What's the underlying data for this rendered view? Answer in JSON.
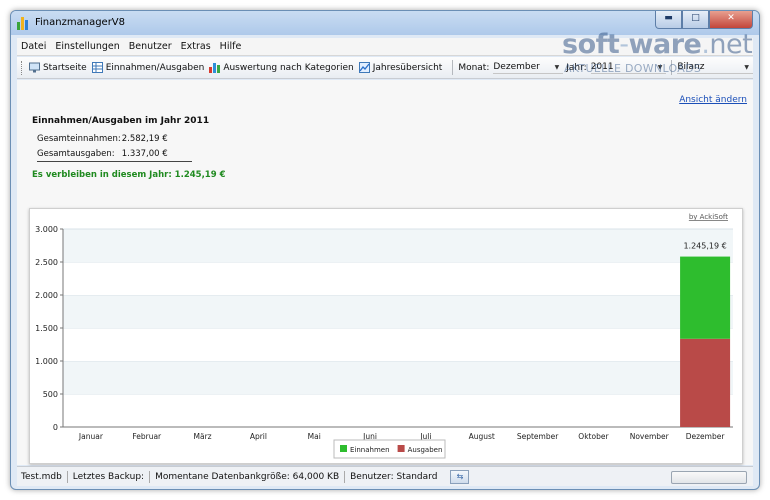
{
  "window": {
    "title": "FinanzmanagerV8"
  },
  "menu": [
    "Datei",
    "Einstellungen",
    "Benutzer",
    "Extras",
    "Hilfe"
  ],
  "toolbar": {
    "start": "Startseite",
    "income_expense": "Einnahmen/Ausgaben",
    "by_category": "Auswertung nach Kategorien",
    "year_overview": "Jahresübersicht",
    "month_label": "Monat:",
    "month_value": "Dezember",
    "year_label": "Jahr:",
    "year_value": "2011",
    "view_value": "Bilanz"
  },
  "summary": {
    "change_view_link": "Ansicht ändern",
    "title": "Einnahmen/Ausgaben im Jahr 2011",
    "income_label": "Gesamteinnahmen:",
    "income_value": "2.582,19 €",
    "expense_label": "Gesamtausgaben:",
    "expense_value": "1.337,00 €",
    "remaining": "Es verbleiben in diesem Jahr: 1.245,19 €"
  },
  "chart_credit": "by AckiSoft",
  "chart_data": {
    "type": "bar",
    "stacked": true,
    "categories": [
      "Januar",
      "Februar",
      "März",
      "April",
      "Mai",
      "Juni",
      "Juli",
      "August",
      "September",
      "Oktober",
      "November",
      "Dezember"
    ],
    "series": [
      {
        "name": "Einnahmen",
        "color": "#2ebd2e",
        "values": [
          0,
          0,
          0,
          0,
          0,
          0,
          0,
          0,
          0,
          0,
          0,
          1245.19
        ]
      },
      {
        "name": "Ausgaben",
        "color": "#b94a48",
        "values": [
          0,
          0,
          0,
          0,
          0,
          0,
          0,
          0,
          0,
          0,
          0,
          1337.0
        ]
      }
    ],
    "y_ticks": [
      "3.000",
      "2.500",
      "2.000",
      "1.500",
      "1.000",
      "500",
      "0"
    ],
    "ylim": [
      0,
      3000
    ],
    "data_labels": [
      {
        "category": "Dezember",
        "text": "1.245,19 €"
      }
    ],
    "legend_position": "bottom"
  },
  "status": {
    "file": "Test.mdb",
    "backup": "Letztes Backup:",
    "db_size": "Momentane Datenbankgröße: 64,000 KB",
    "user": "Benutzer:  Standard"
  },
  "watermark": {
    "text1": "soft",
    "text2": "ware",
    "text3": "net",
    "sub": "AKTUELLE DOWNLOADS"
  }
}
